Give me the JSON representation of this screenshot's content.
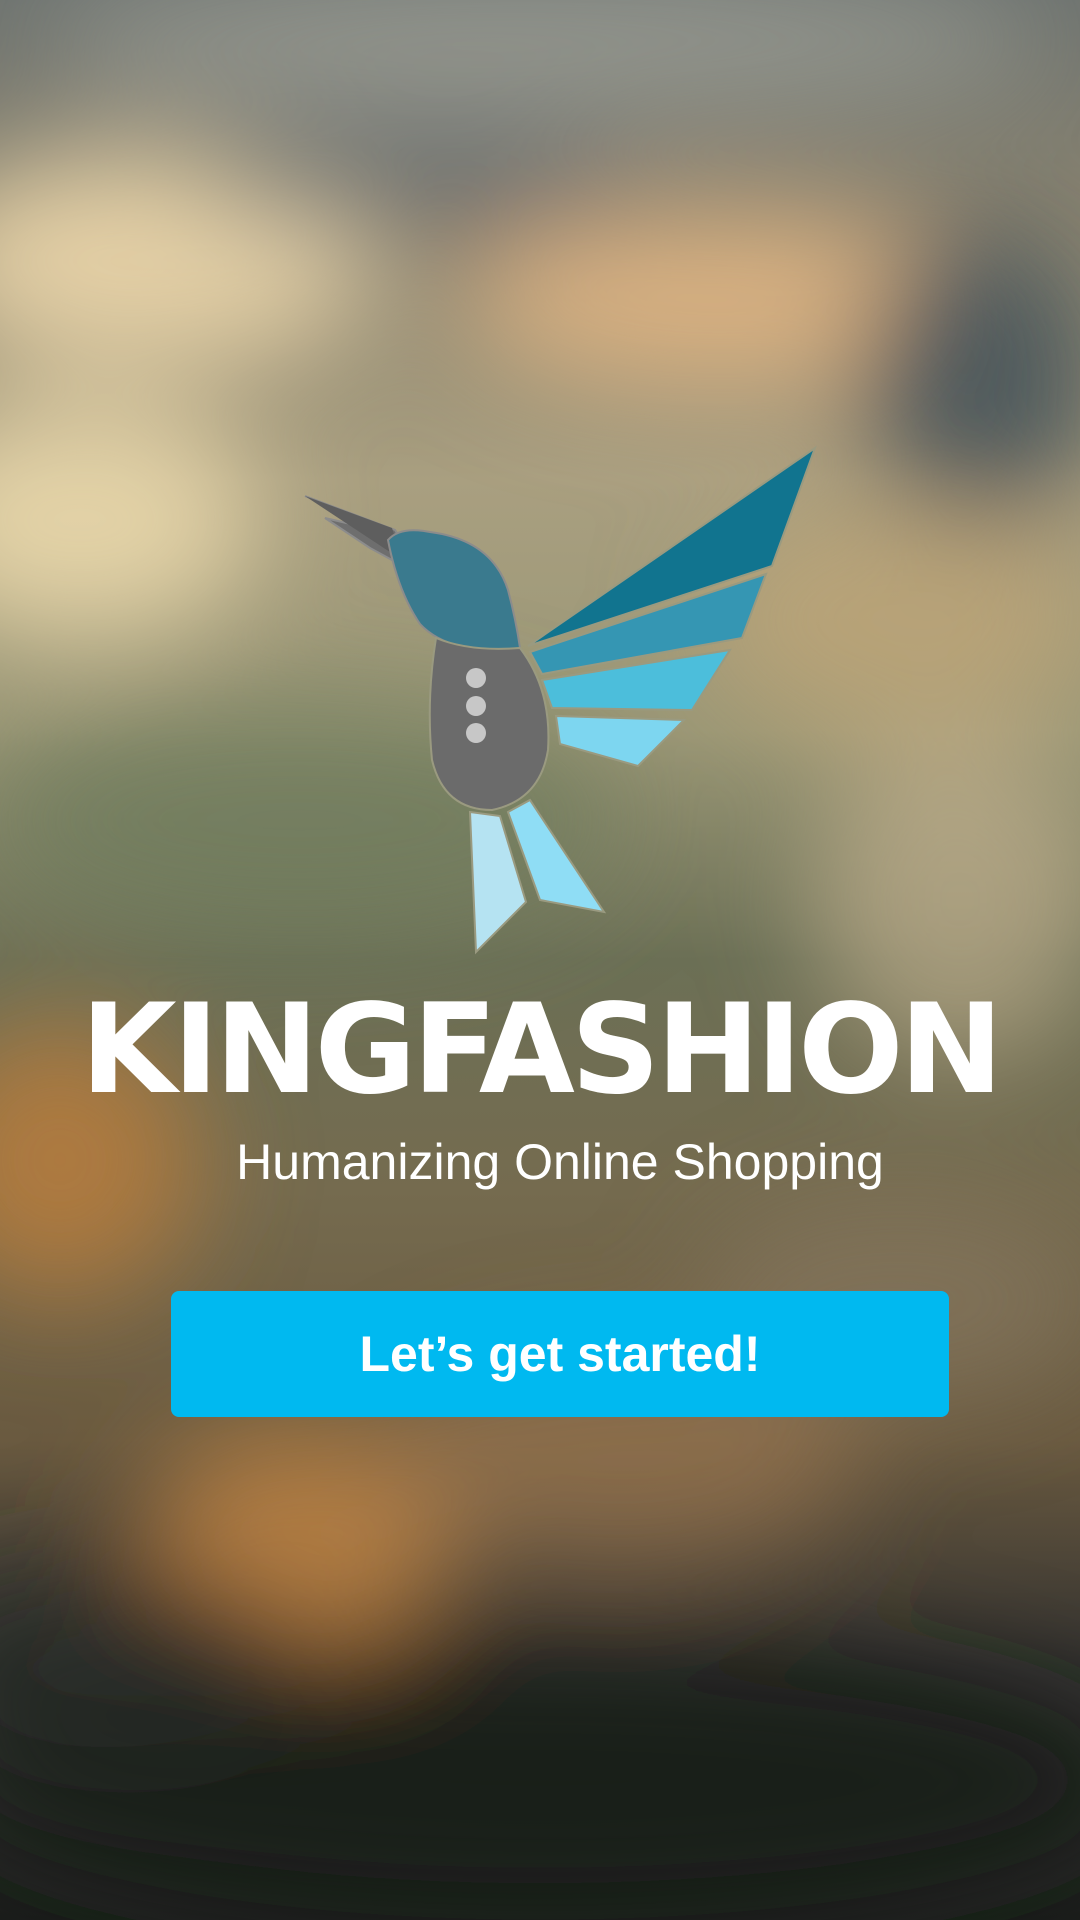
{
  "brand": {
    "name": "KINGFASHION",
    "tagline": "Humanizing Online Shopping"
  },
  "actions": {
    "get_started_label": "Let’s get started!"
  },
  "logo": {
    "icon": "hummingbird-logo-icon"
  },
  "colors": {
    "accent": "#00B9F0",
    "text": "#FFFFFF",
    "bird_body": "#6B6B6B",
    "bird_head": "#3A7A8E",
    "wing_dark": "#11748F",
    "wing_mid": "#3596B3",
    "wing_light": "#4CBEDB",
    "wing_lightest": "#7DD6F0",
    "tail_light": "#B5E3F2",
    "tail_mid": "#8FDDF5"
  }
}
